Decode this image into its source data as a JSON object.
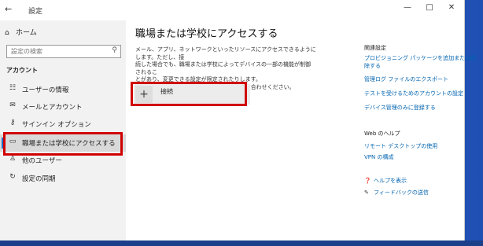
{
  "window": {
    "title": "設定",
    "back_icon": "←",
    "minimize": "—",
    "maximize": "□",
    "close": "✕"
  },
  "sidebar": {
    "home": {
      "icon": "⌂",
      "label": "ホーム"
    },
    "search": {
      "placeholder": "設定の検索",
      "icon": "⚲"
    },
    "section": "アカウント",
    "items": [
      {
        "icon": "☷",
        "label": "ユーザーの情報"
      },
      {
        "icon": "✉",
        "label": "メールとアカウント"
      },
      {
        "icon": "⚷",
        "label": "サインイン オプション"
      },
      {
        "icon": "▭",
        "label": "職場または学校にアクセスする"
      },
      {
        "icon": "♙",
        "label": "他のユーザー"
      },
      {
        "icon": "↻",
        "label": "設定の同期"
      }
    ]
  },
  "main": {
    "heading": "職場または学校にアクセスする",
    "description_lines": [
      "メール、アプリ、ネットワークといったリソースにアクセスできるようにします。ただし、接",
      "続した場合でも、職場または学校によってデバイスの一部の機能が制御されるこ",
      "とがあり、変更できる設定が限定されたりします。",
      "具体的な情報については、職場や学校にお問い合わせください。"
    ],
    "connect": {
      "plus": "+",
      "label": "接続"
    }
  },
  "related": {
    "header": "関連設定",
    "links": [
      "プロビジョニング パッケージを追加または削",
      "除する",
      "管理ログ ファイルのエクスポート",
      "テストを受けるためのアカウントの設定",
      "デバイス管理のみに登録する"
    ],
    "web_header": "Web のヘルプ",
    "web_links": [
      "リモート デスクトップの使用",
      "VPN の構成"
    ],
    "help": {
      "icon": "❓",
      "label": "ヘルプを表示"
    },
    "feedback": {
      "icon": "✎",
      "label": "フィードバックの送信"
    }
  }
}
